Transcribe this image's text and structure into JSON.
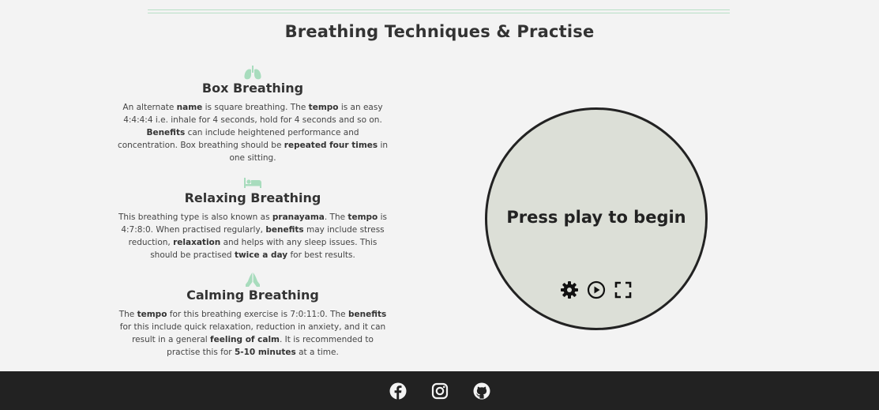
{
  "page": {
    "title": "Breathing Techniques & Practise"
  },
  "colors": {
    "accent": "#a8dcbd",
    "background": "#f3f3f3",
    "circle_fill": "#dcdfd7",
    "footer": "#222222"
  },
  "techniques": [
    {
      "icon": "lungs-icon",
      "title": "Box Breathing",
      "body": [
        {
          "t": "An alternate "
        },
        {
          "t": "name",
          "b": true
        },
        {
          "t": " is square breathing. The "
        },
        {
          "t": "tempo",
          "b": true
        },
        {
          "t": " is an easy 4:4:4:4 i.e. inhale for 4 seconds, hold for 4 seconds and so on. "
        },
        {
          "t": "Benefits",
          "b": true
        },
        {
          "t": " can include heightened performance and concentration. Box breathing should be "
        },
        {
          "t": "repeated four times",
          "b": true
        },
        {
          "t": " in one sitting."
        }
      ]
    },
    {
      "icon": "bed-icon",
      "title": "Relaxing Breathing",
      "body": [
        {
          "t": "This breathing type is also known as "
        },
        {
          "t": "pranayama",
          "b": true
        },
        {
          "t": ". The "
        },
        {
          "t": "tempo",
          "b": true
        },
        {
          "t": " is 4:7:8:0. When practised regularly, "
        },
        {
          "t": "benefits",
          "b": true
        },
        {
          "t": " may include stress reduction, "
        },
        {
          "t": "relaxation",
          "b": true
        },
        {
          "t": " and helps with any sleep issues. This should be practised "
        },
        {
          "t": "twice a day",
          "b": true
        },
        {
          "t": " for best results."
        }
      ]
    },
    {
      "icon": "praying-hands-icon",
      "title": "Calming Breathing",
      "body": [
        {
          "t": "The "
        },
        {
          "t": "tempo",
          "b": true
        },
        {
          "t": " for this breathing exercise is 7:0:11:0. The "
        },
        {
          "t": "benefits",
          "b": true
        },
        {
          "t": " for this include quick relaxation, reduction in anxiety, and it can result in a general "
        },
        {
          "t": "feeling of calm",
          "b": true
        },
        {
          "t": ". It is recommended to practise this for "
        },
        {
          "t": "5-10 minutes",
          "b": true
        },
        {
          "t": " at a time."
        }
      ]
    }
  ],
  "player": {
    "prompt": "Press play to begin",
    "controls": [
      "gear-icon",
      "play-icon",
      "fullscreen-icon"
    ]
  },
  "footer": {
    "social": [
      "facebook-icon",
      "instagram-icon",
      "github-icon"
    ]
  }
}
